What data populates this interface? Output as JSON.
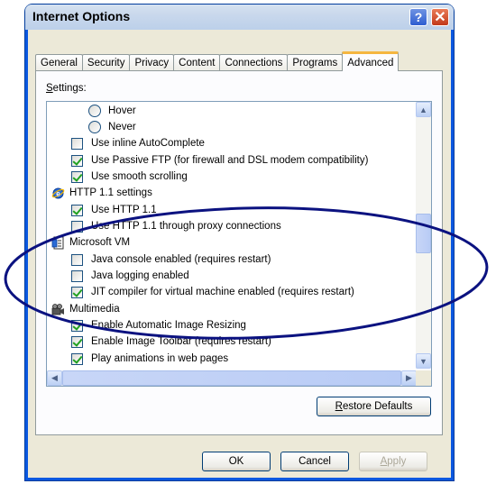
{
  "window": {
    "title": "Internet Options",
    "help_glyph": "?",
    "close_glyph": "✕"
  },
  "tabs": [
    {
      "label": "General"
    },
    {
      "label": "Security"
    },
    {
      "label": "Privacy"
    },
    {
      "label": "Content"
    },
    {
      "label": "Connections"
    },
    {
      "label": "Programs"
    },
    {
      "label": "Advanced",
      "active": true
    }
  ],
  "settings": {
    "label_first": "S",
    "label_rest": "ettings:",
    "rows": [
      {
        "kind": "radio",
        "label": "Hover"
      },
      {
        "kind": "radio",
        "label": "Never"
      },
      {
        "kind": "check",
        "checked": false,
        "label": "Use inline AutoComplete"
      },
      {
        "kind": "check",
        "checked": true,
        "label": "Use Passive FTP (for firewall and DSL modem compatibility)"
      },
      {
        "kind": "check",
        "checked": true,
        "label": "Use smooth scrolling"
      },
      {
        "kind": "category",
        "icon": "ie-globe-icon",
        "label": "HTTP 1.1 settings"
      },
      {
        "kind": "check",
        "checked": true,
        "label": "Use HTTP 1.1"
      },
      {
        "kind": "check",
        "checked": false,
        "label": "Use HTTP 1.1 through proxy connections"
      },
      {
        "kind": "category",
        "icon": "document-icon",
        "label": "Microsoft VM"
      },
      {
        "kind": "check",
        "checked": false,
        "label": "Java console enabled (requires restart)"
      },
      {
        "kind": "check",
        "checked": false,
        "label": "Java logging enabled"
      },
      {
        "kind": "check",
        "checked": true,
        "label": "JIT compiler for virtual machine enabled (requires restart)"
      },
      {
        "kind": "category",
        "icon": "multimedia-icon",
        "label": "Multimedia"
      },
      {
        "kind": "check",
        "checked": true,
        "label": "Enable Automatic Image Resizing"
      },
      {
        "kind": "check",
        "checked": true,
        "label": "Enable Image Toolbar (requires restart)"
      },
      {
        "kind": "check",
        "checked": true,
        "label": "Play animations in web pages"
      }
    ]
  },
  "buttons": {
    "restore_first": "R",
    "restore_rest": "estore Defaults",
    "ok": "OK",
    "cancel": "Cancel",
    "apply_first": "A",
    "apply_rest": "pply"
  },
  "colors": {
    "annotation": "#0b1280",
    "check": "#21a121"
  }
}
